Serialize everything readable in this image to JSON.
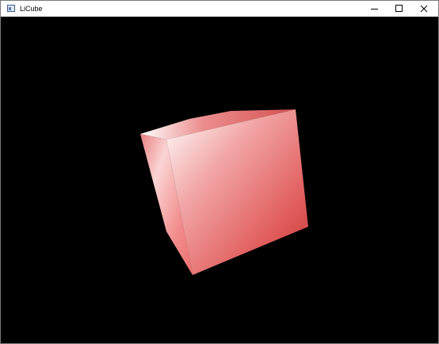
{
  "window": {
    "title": "LiCube",
    "title_icon": "app-window-icon",
    "controls": {
      "minimize_icon": "minimize-icon",
      "maximize_icon": "maximize-icon",
      "close_icon": "close-icon"
    }
  },
  "scene": {
    "background_color": "#000000",
    "object": "cube",
    "cube_color": "#e05a5a",
    "highlight_color": "#ffffff",
    "shadow_color": "#b02a2a"
  }
}
